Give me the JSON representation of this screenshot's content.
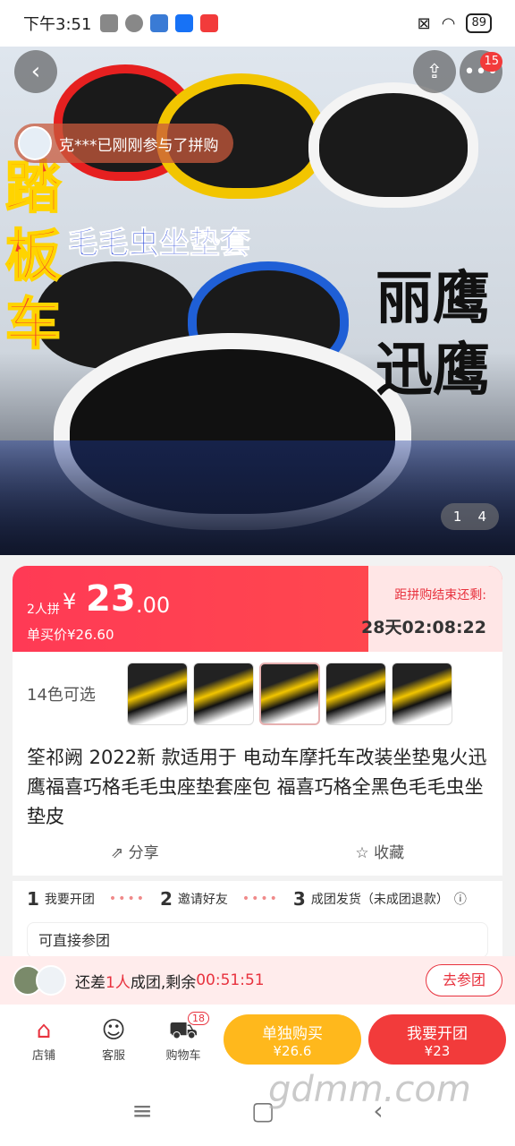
{
  "status_bar": {
    "time": "下午3:51",
    "battery": "89",
    "app_icons": [
      "silent-icon",
      "alarm-icon",
      "mail-icon",
      "zhihu-icon",
      "app-icon"
    ]
  },
  "hero": {
    "toast_text": "克***已刚刚参与了拼购",
    "image_text_1": "踏板车",
    "image_text_2": "毛毛虫坐垫套",
    "image_text_3": "丽鹰",
    "image_text_4": "迅鹰",
    "cart_badge": "15",
    "page_current": "1",
    "page_total": "4"
  },
  "price": {
    "group_label": "2人拼",
    "currency": "¥",
    "integer": "23",
    "decimal": ".00",
    "single_price": "单买价¥26.60",
    "countdown_label": "距拼购结束还剩:",
    "countdown": "28天02:08:22"
  },
  "product": {
    "colors_label": "14色可选",
    "title": "筌祁阙 2022新 款适用于 电动车摩托车改装坐垫鬼火迅鹰福喜巧格毛毛虫座垫套座包 福喜巧格全黑色毛毛虫坐垫皮",
    "share_label": "分享",
    "favorite_label": "收藏"
  },
  "steps": {
    "step1_num": "1",
    "step1": "我要开团",
    "step2_num": "2",
    "step2": "邀请好友",
    "step3_num": "3",
    "step3": "成团发货（未成团退款）",
    "direct_join": "可直接参团"
  },
  "join_bar": {
    "text_prefix": "还差",
    "count": "1人",
    "text_mid": "成团,剩余",
    "remaining": "00:51:51",
    "join_button": "去参团"
  },
  "bottom_bar": {
    "shop": "店铺",
    "service": "客服",
    "cart": "购物车",
    "cart_count": "18",
    "buy_single": "单独购买",
    "buy_single_price": "¥26.6",
    "buy_group": "我要开团",
    "buy_group_price": "¥23"
  },
  "watermark": "gdmm.com",
  "colors": {
    "accent": "#f23b3b",
    "yellow": "#ffb81c"
  }
}
